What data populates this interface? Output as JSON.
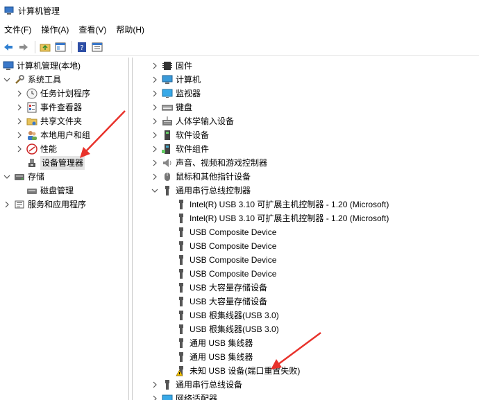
{
  "window": {
    "title": "计算机管理"
  },
  "menu": [
    {
      "label": "文件(F)",
      "name": "menu-file"
    },
    {
      "label": "操作(A)",
      "name": "menu-action"
    },
    {
      "label": "查看(V)",
      "name": "menu-view"
    },
    {
      "label": "帮助(H)",
      "name": "menu-help"
    }
  ],
  "left_tree": {
    "root": "计算机管理(本地)",
    "system_tools": "系统工具",
    "task_scheduler": "任务计划程序",
    "event_viewer": "事件查看器",
    "shared_folders": "共享文件夹",
    "local_users": "本地用户和组",
    "performance": "性能",
    "device_manager": "设备管理器",
    "storage": "存储",
    "disk_management": "磁盘管理",
    "services_apps": "服务和应用程序"
  },
  "device_tree": {
    "firmware": "固件",
    "computer": "计算机",
    "monitors": "监视器",
    "keyboards": "键盘",
    "hid": "人体学输入设备",
    "software_devices": "软件设备",
    "software_components": "软件组件",
    "sound": "声音、视频和游戏控制器",
    "mice": "鼠标和其他指针设备",
    "usb_controllers": "通用串行总线控制器",
    "usb_children": [
      "Intel(R) USB 3.10 可扩展主机控制器 - 1.20 (Microsoft)",
      "Intel(R) USB 3.10 可扩展主机控制器 - 1.20 (Microsoft)",
      "USB Composite Device",
      "USB Composite Device",
      "USB Composite Device",
      "USB Composite Device",
      "USB 大容量存储设备",
      "USB 大容量存储设备",
      "USB 根集线器(USB 3.0)",
      "USB 根集线器(USB 3.0)",
      "通用 USB 集线器",
      "通用 USB 集线器",
      "未知 USB 设备(端口重置失败)"
    ],
    "usb_devices": "通用串行总线设备",
    "network_adapters": "网络适配器"
  },
  "colors": {
    "selected_bg": "#e5e5e5",
    "arrow_red": "#e8322b",
    "warning_yellow": "#f2c200"
  }
}
